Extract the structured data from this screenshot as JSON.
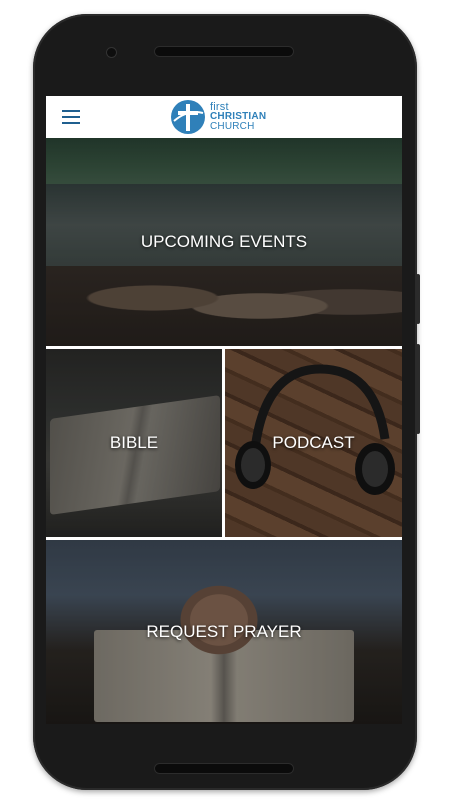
{
  "app": {
    "logo_line1": "first",
    "logo_line2": "CHRISTIAN",
    "logo_line3": "CHURCH",
    "brand_color": "#2f80b9",
    "menu_icon": "hamburger-menu-icon"
  },
  "tiles": {
    "events": {
      "label": "UPCOMING EVENTS"
    },
    "bible": {
      "label": "BIBLE"
    },
    "podcast": {
      "label": "PODCAST"
    },
    "prayer": {
      "label": "REQUEST PRAYER"
    }
  }
}
